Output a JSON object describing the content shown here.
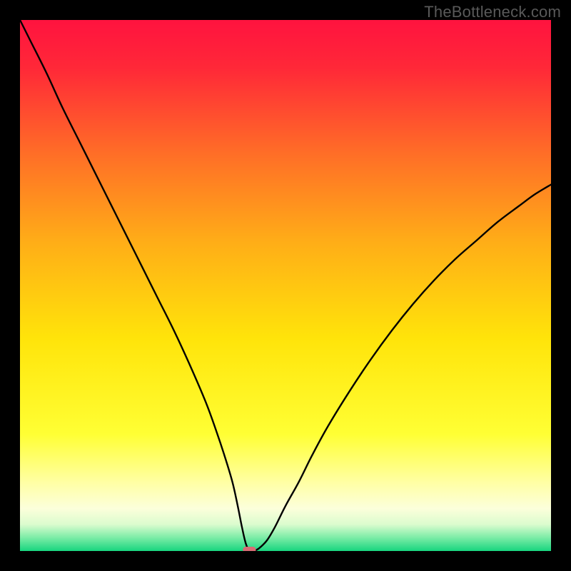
{
  "watermark": {
    "text": "TheBottleneck.com"
  },
  "chart_data": {
    "type": "line",
    "title": "",
    "xlabel": "",
    "ylabel": "",
    "xlim": [
      0,
      100
    ],
    "ylim": [
      0,
      100
    ],
    "series": [
      {
        "name": "bottleneck-curve",
        "x": [
          0,
          2,
          5,
          8,
          11,
          14,
          17,
          20,
          23,
          26,
          29,
          32,
          35,
          37,
          38.5,
          40,
          41,
          41.8,
          42.5,
          43.2,
          44,
          45,
          46.5,
          48,
          50,
          52.5,
          55,
          58,
          62,
          66,
          70,
          74,
          78,
          82,
          86,
          90,
          94,
          97,
          100
        ],
        "y": [
          100,
          96,
          90,
          83.5,
          77.5,
          71.5,
          65.5,
          59.5,
          53.5,
          47.5,
          41.5,
          35,
          28,
          22.5,
          18,
          13,
          8.5,
          4.5,
          1.5,
          0,
          0,
          0.5,
          2,
          4.5,
          8.5,
          13,
          18,
          23.5,
          30,
          36,
          41.5,
          46.5,
          51,
          55,
          58.5,
          62,
          65,
          67.2,
          69
        ]
      }
    ],
    "gradient_stops": [
      {
        "offset": 0.0,
        "color": "#FF133F"
      },
      {
        "offset": 0.09,
        "color": "#FF2838"
      },
      {
        "offset": 0.25,
        "color": "#FF6D27"
      },
      {
        "offset": 0.42,
        "color": "#FFAE17"
      },
      {
        "offset": 0.6,
        "color": "#FFE40A"
      },
      {
        "offset": 0.78,
        "color": "#FFFF34"
      },
      {
        "offset": 0.87,
        "color": "#FFFFA3"
      },
      {
        "offset": 0.92,
        "color": "#FCFFDB"
      },
      {
        "offset": 0.95,
        "color": "#DBFCCE"
      },
      {
        "offset": 0.975,
        "color": "#7BECA6"
      },
      {
        "offset": 1.0,
        "color": "#18D57F"
      }
    ],
    "marker": {
      "x": 43.2,
      "y": 0,
      "color": "#D96B74"
    },
    "minimum_flat": {
      "x_start": 41.8,
      "x_end": 45.0,
      "y": 0
    }
  }
}
